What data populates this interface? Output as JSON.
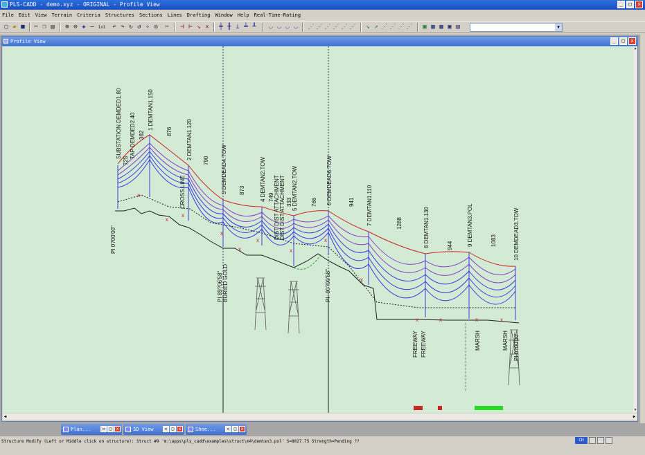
{
  "window": {
    "title": "PLS-CADD - demo.xyz - ORIGINAL - Profile View",
    "min": "_",
    "max": "□",
    "close": "x"
  },
  "menu": [
    "File",
    "Edit",
    "View",
    "Terrain",
    "Criteria",
    "Structures",
    "Sections",
    "Lines",
    "Drafting",
    "Window",
    "Help",
    "Real-Time-Rating"
  ],
  "toolbar_icons": [
    "new-file-icon",
    "open-file-icon",
    "save-icon",
    "cut-icon",
    "copy-icon",
    "paste-icon",
    "zoom-in-icon",
    "zoom-out-icon",
    "pan-icon",
    "zoom-reset-icon"
  ],
  "toolbar": {
    "zoom_label": "1x1"
  },
  "doc": {
    "title": "Profile View"
  },
  "minimized_windows": [
    {
      "label": "Plan..."
    },
    {
      "label": "3D View"
    },
    {
      "label": "Shee..."
    }
  ],
  "status": {
    "text": "Structure Modify (Left or Middle click on structure): Struct #9 'm:\\apps\\pls_cadd\\examples\\struct\\m4\\demtan3.pol'  S=8027.75 Strength=Pending  ??",
    "lang": "CH"
  },
  "profile": {
    "structures": [
      {
        "label": "SUBSTATION DEMDED1.80"
      },
      {
        "label": "TAP DEMDED2.40"
      },
      {
        "label": "1 DEMTAN1.150"
      },
      {
        "label": "2 DEMTAN1.120"
      },
      {
        "label": "3 DEMDEAD4.TOW"
      },
      {
        "label": "4 DEMTAN2.TOW"
      },
      {
        "label": "DIST DIST ATTACHMENT"
      },
      {
        "label": "DIST DIST ATTACHMENT"
      },
      {
        "label": "5 DEMTAN2.TOW"
      },
      {
        "label": "6 DEMDEAD6.TOW"
      },
      {
        "label": "7 DEMTAN1.110"
      },
      {
        "label": "8 DEMTAN1.130"
      },
      {
        "label": "9 DEMTAN3.POL"
      },
      {
        "label": "10 DEMDEAD3.TOW"
      }
    ],
    "spans": [
      {
        "label": "725"
      },
      {
        "label": "382"
      },
      {
        "label": "876"
      },
      {
        "label": "790"
      },
      {
        "label": "873"
      },
      {
        "label": "749"
      },
      {
        "label": "333"
      },
      {
        "label": "766"
      },
      {
        "label": "941"
      },
      {
        "label": "1288"
      },
      {
        "label": "944"
      },
      {
        "label": "1083"
      }
    ],
    "crossing_label": "CROSS LINE",
    "pi_labels": [
      {
        "label": "PI 0?00'00\""
      },
      {
        "label": "PI 89?06'58\""
      },
      {
        "label": "BURIED GOLD"
      },
      {
        "label": "PI -90?00'58\""
      },
      {
        "label": "PI 0?00'00\""
      }
    ],
    "bottom_labels": [
      {
        "label": "FREEWAY"
      },
      {
        "label": "FREEWAY"
      },
      {
        "label": "MARSH"
      },
      {
        "label": "MARSH"
      }
    ],
    "colors": {
      "red": "#cc2222",
      "blue": "#3a3ae0",
      "purple": "#8a3ec8",
      "ground": "#1a1a1a",
      "green": "#22cc22"
    }
  }
}
